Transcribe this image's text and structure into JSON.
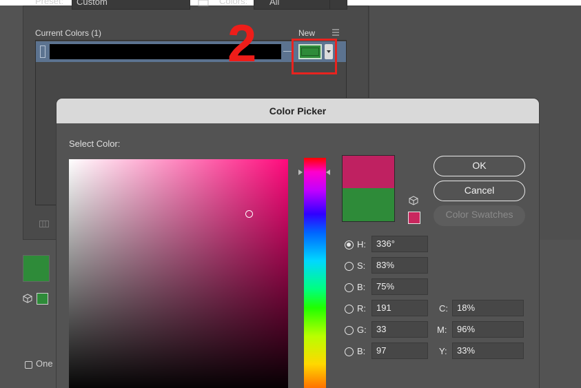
{
  "background": {
    "preset_label": "Preset:",
    "preset_value": "Custom",
    "colors_label": "Colors:",
    "colors_value": "All",
    "current_colors_label": "Current Colors (1)",
    "new_label": "New",
    "current_color_hex": "#000000",
    "new_color_hex": "#2E8B39",
    "annotation_number": "2",
    "checkbox_label": "One"
  },
  "dialog": {
    "title": "Color Picker",
    "select_color_label": "Select Color:",
    "new_color_hex": "#BF2161",
    "original_color_hex": "#2E8B39",
    "buttons": {
      "ok": "OK",
      "cancel": "Cancel",
      "color_swatches": "Color Swatches"
    },
    "fields": {
      "h": {
        "label": "H:",
        "value": "336°",
        "selected": true
      },
      "s": {
        "label": "S:",
        "value": "83%"
      },
      "b": {
        "label": "B:",
        "value": "75%"
      },
      "r": {
        "label": "R:",
        "value": "191"
      },
      "g": {
        "label": "G:",
        "value": "33"
      },
      "b2": {
        "label": "B:",
        "value": "97"
      },
      "c": {
        "label": "C:",
        "value": "18%"
      },
      "m": {
        "label": "M:",
        "value": "96%"
      },
      "y": {
        "label": "Y:",
        "value": "33%"
      }
    }
  }
}
